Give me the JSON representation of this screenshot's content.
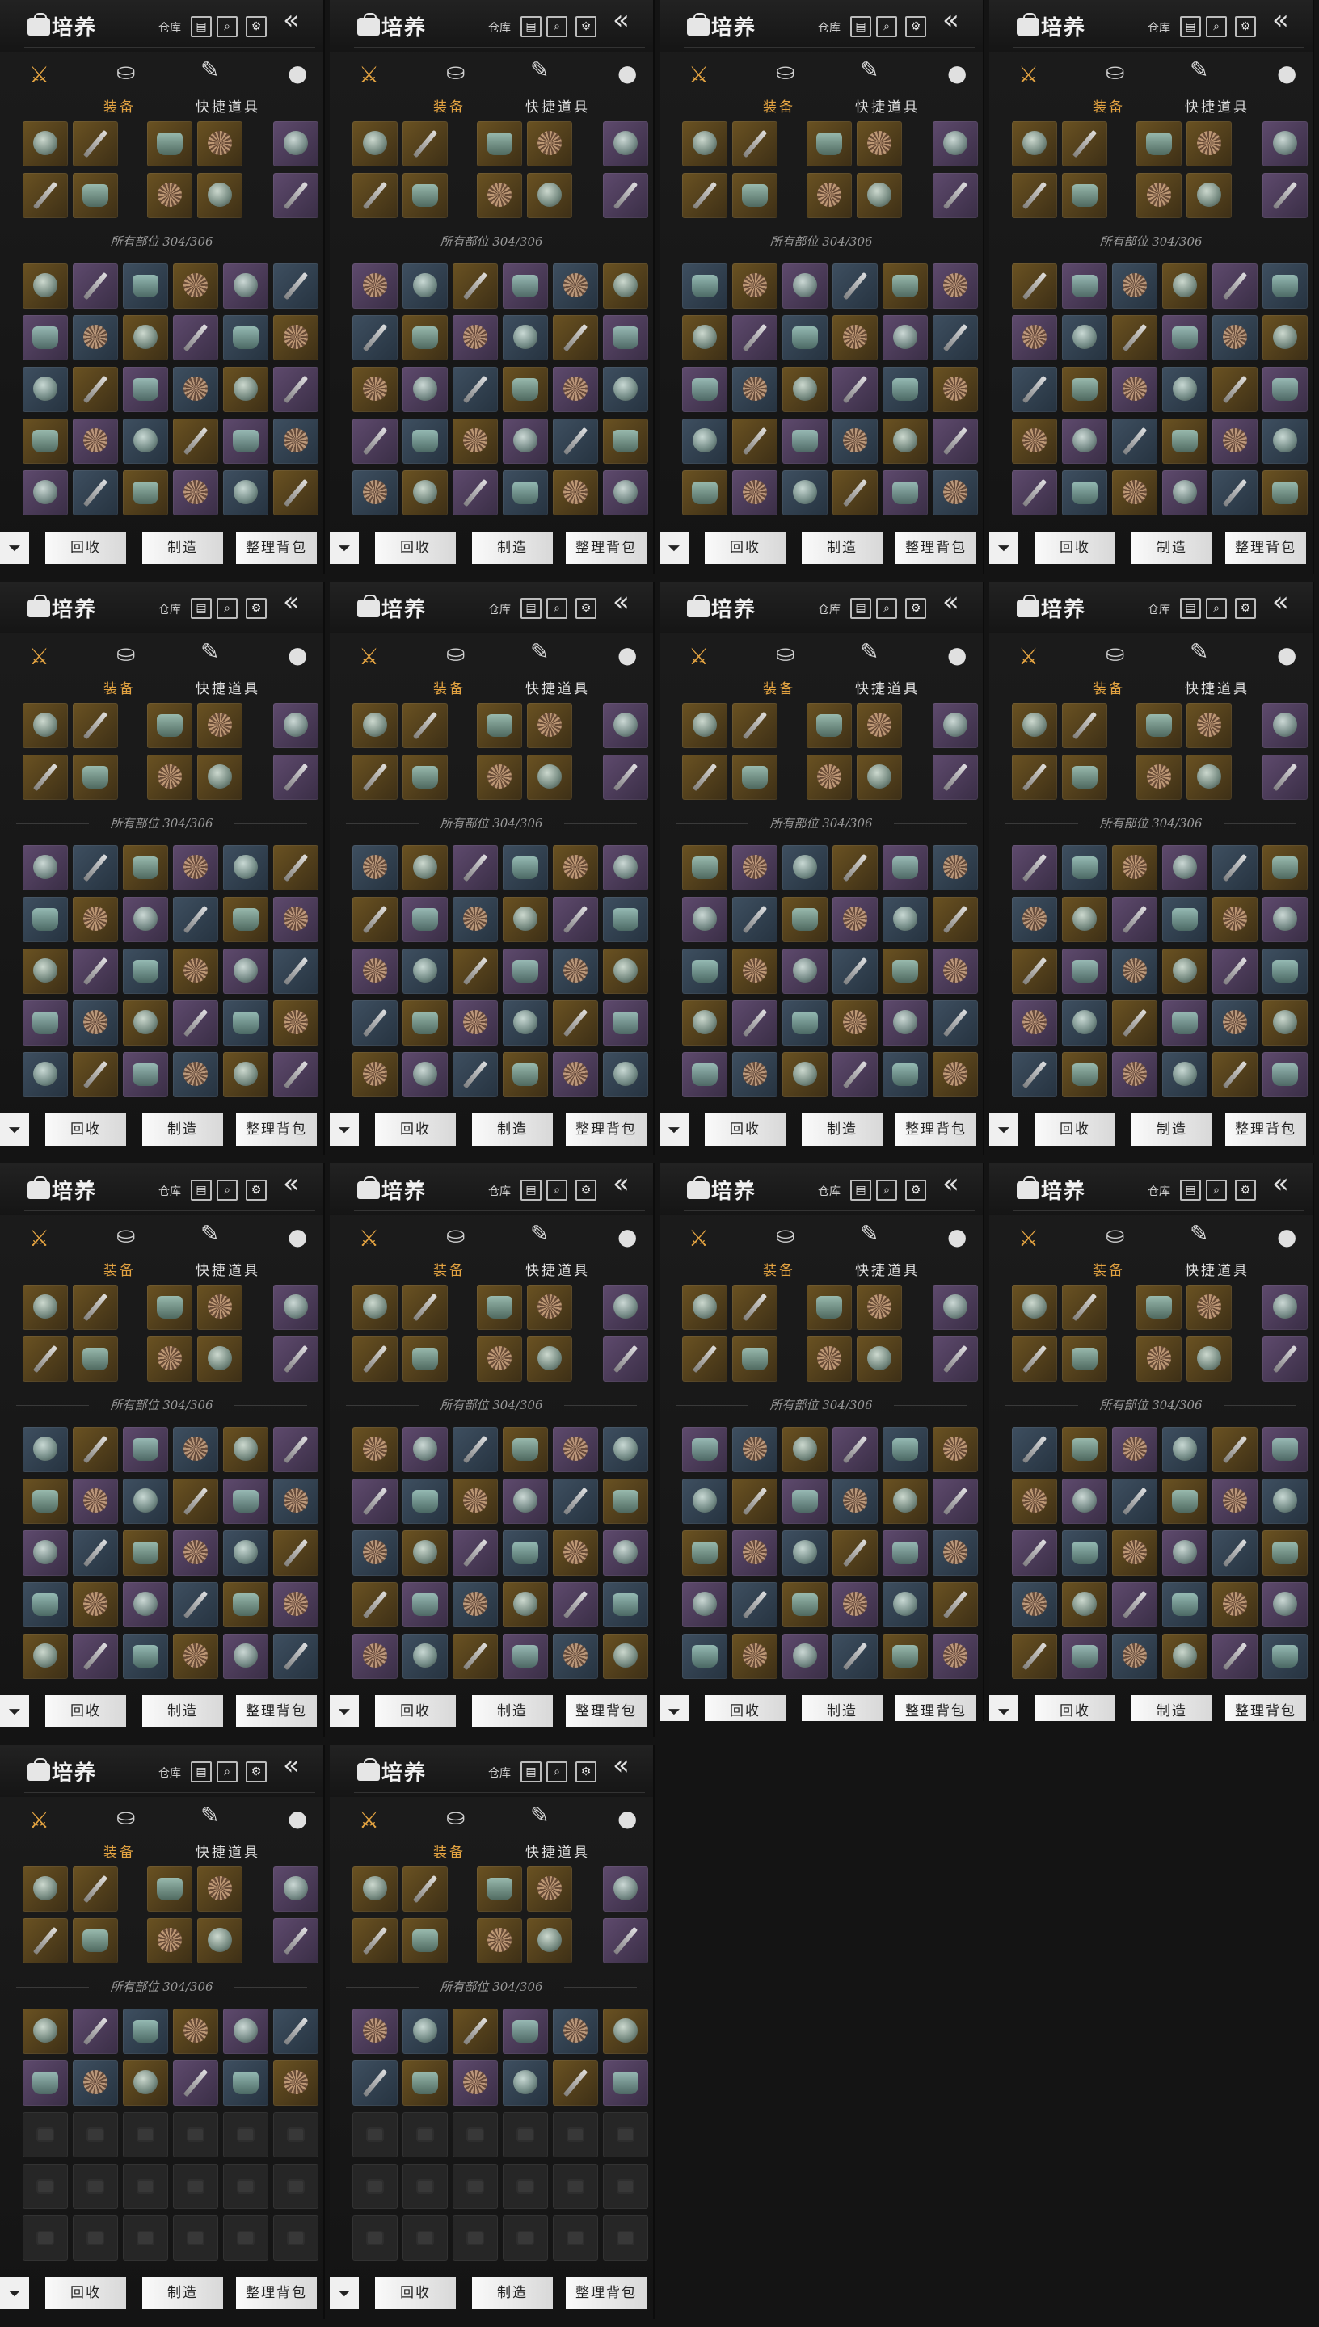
{
  "panel_count": 14,
  "header": {
    "title": "培养",
    "warehouse_label": "仓库",
    "bag_icon": "bag-icon",
    "back_icon": "double-chevron-left-icon",
    "buttons": [
      "warehouse-icon",
      "search-icon",
      "gear-icon"
    ]
  },
  "tabs": {
    "items": [
      {
        "label": "装备",
        "active": true,
        "icon": "crossed-swords-icon"
      },
      {
        "label": "快捷道具",
        "active": false,
        "icon": "pouch-icon"
      }
    ],
    "extra_icons": [
      "token-icon",
      "scroll-icon"
    ]
  },
  "summary": {
    "text": "所有部位 304/306"
  },
  "actions": {
    "filter_icon": "filter-icon",
    "recycle": "回收",
    "craft": "制造",
    "sort": "整理背包"
  },
  "colors": {
    "active_tab": "#e3a341",
    "gold_quality": "#6a5222",
    "purple_quality": "#5e4a6d",
    "blue_quality": "#3e4f60"
  }
}
